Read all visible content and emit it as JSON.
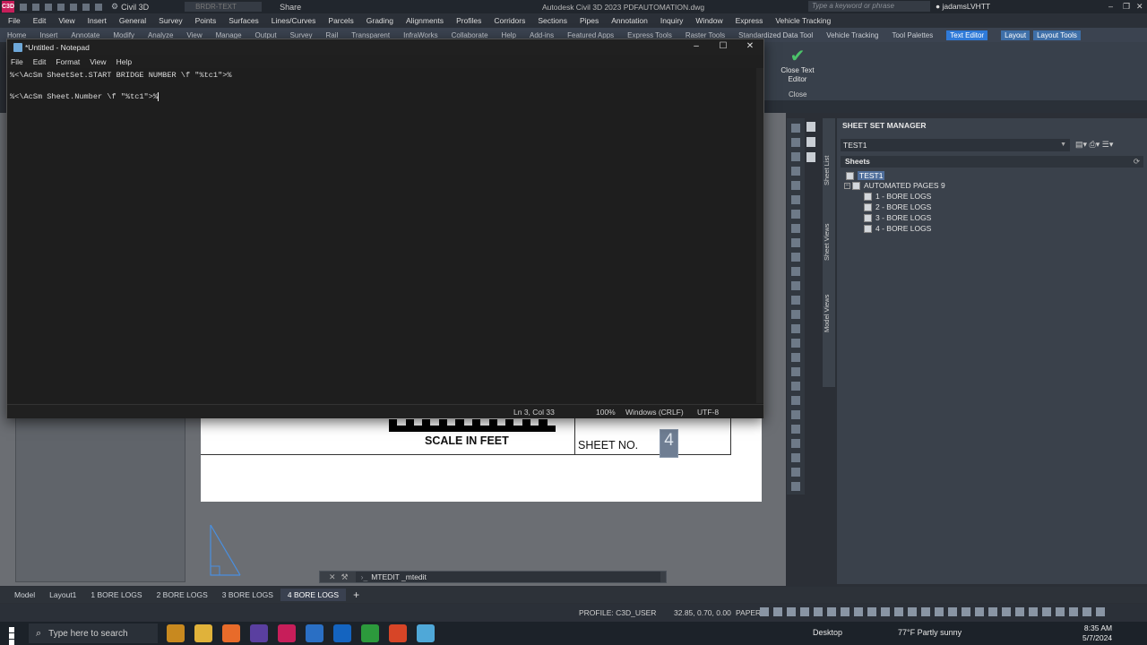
{
  "acad": {
    "workspace": "Civil 3D",
    "layer": "BRDR-TEXT",
    "share": "Share",
    "title": "Autodesk Civil 3D 2023    PDFAUTOMATION.dwg",
    "search_placeholder": "Type a keyword or phrase",
    "user": "jadamsLVHTT",
    "menu": [
      "File",
      "Edit",
      "View",
      "Insert",
      "General",
      "Survey",
      "Points",
      "Surfaces",
      "Lines/Curves",
      "Parcels",
      "Grading",
      "Alignments",
      "Profiles",
      "Corridors",
      "Sections",
      "Pipes",
      "Annotation",
      "Inquiry",
      "Window",
      "Express",
      "Vehicle Tracking"
    ],
    "ribbon_tabs": [
      "Home",
      "Insert",
      "Annotate",
      "Modify",
      "Analyze",
      "View",
      "Manage",
      "Output",
      "Survey",
      "Rail",
      "Transparent",
      "InfraWorks",
      "Collaborate",
      "Help",
      "Add-ins",
      "Featured Apps",
      "Express Tools",
      "Raster Tools",
      "Standardized Data Tool",
      "Vehicle Tracking",
      "Tool Palettes"
    ],
    "ribbon_active": "Text Editor",
    "ribbon_ctx": [
      "Layout",
      "Layout Tools"
    ],
    "close_text_editor": "Close Text Editor",
    "close_panel": "Close"
  },
  "notepad": {
    "title": "*Untitled - Notepad",
    "menu": [
      "File",
      "Edit",
      "Format",
      "View",
      "Help"
    ],
    "lines": [
      "%<\\AcSm SheetSet.START BRIDGE NUMBER \\f \"%tc1\">%",
      "",
      "%<\\AcSm Sheet.Number \\f \"%tc1\">%"
    ],
    "status": {
      "position": "Ln 3, Col 33",
      "zoom": "100%",
      "eol": "Windows (CRLF)",
      "encoding": "UTF-8"
    }
  },
  "drawing": {
    "scale_label": "SCALE IN FEET",
    "sheet_no_label": "SHEET NO.",
    "sheet_no_value": "4",
    "command": "MTEDIT _mtedit"
  },
  "ssm": {
    "title": "SHEET SET MANAGER",
    "combo": "TEST1",
    "sheets_header": "Sheets",
    "tabs": [
      "Sheet List",
      "Sheet Views",
      "Model Views"
    ],
    "root": "TEST1",
    "subset": "AUTOMATED PAGES 9",
    "sheets": [
      "1 - BORE LOGS",
      "2 - BORE LOGS",
      "3 - BORE LOGS",
      "4 - BORE LOGS"
    ]
  },
  "layouts": {
    "tabs": [
      "Model",
      "Layout1",
      "1 BORE LOGS",
      "2 BORE LOGS",
      "3 BORE LOGS",
      "4 BORE LOGS"
    ],
    "active": "4 BORE LOGS"
  },
  "statusbar": {
    "profile": "PROFILE: C3D_USER",
    "coords": "32.85, 0.70, 0.00",
    "space": "PAPER"
  },
  "taskbar": {
    "search_placeholder": "Type here to search",
    "desktop": "Desktop",
    "weather": "77°F  Partly sunny",
    "time": "8:35 AM",
    "date": "5/7/2024"
  }
}
